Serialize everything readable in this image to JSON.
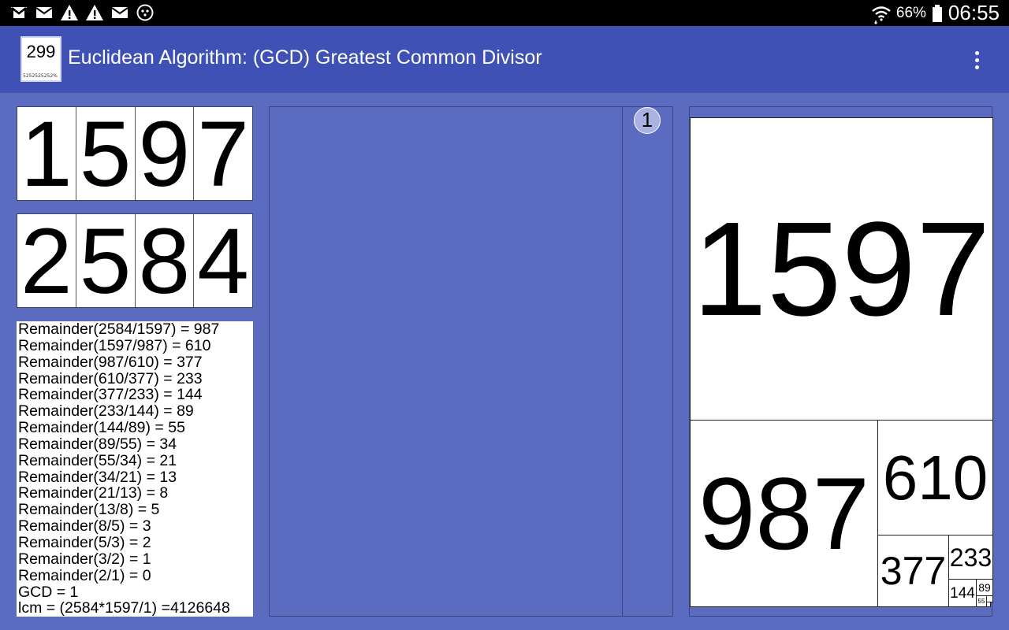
{
  "status_bar": {
    "left_icons": [
      "gmail-icon",
      "email-icon",
      "warning-icon",
      "warning-icon",
      "email-icon",
      "dots-icon"
    ],
    "battery": "66%",
    "time": "06:55"
  },
  "app_bar": {
    "icon_number": "299",
    "icon_subtext": "5252525252%",
    "title": "Euclidean Algorithm: (GCD) Greatest Common Divisor"
  },
  "input_a": [
    "1",
    "5",
    "9",
    "7"
  ],
  "input_b": [
    "2",
    "5",
    "8",
    "4"
  ],
  "steps": [
    "Remainder(2584/1597) = 987",
    "Remainder(1597/987) = 610",
    "Remainder(987/610) = 377",
    "Remainder(610/377) = 233",
    "Remainder(377/233) = 144",
    "Remainder(233/144) = 89",
    "Remainder(144/89) = 55",
    "Remainder(89/55) = 34",
    "Remainder(55/34) = 21",
    "Remainder(34/21) = 13",
    "Remainder(21/13) = 8",
    "Remainder(13/8) = 5",
    "Remainder(8/5) = 3",
    "Remainder(5/3) = 2",
    "Remainder(3/2) = 1",
    "Remainder(2/1) = 0",
    "GCD = 1",
    "lcm = (2584*1597/1) =4126648"
  ],
  "middle": {
    "badge": "1"
  },
  "squares": {
    "s1597": "1597",
    "s987": "987",
    "s610": "610",
    "s377": "377",
    "s233": "233",
    "s144": "144",
    "s89": "89",
    "s55": "55"
  }
}
